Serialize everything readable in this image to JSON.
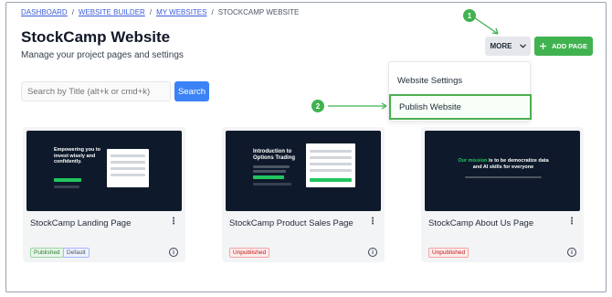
{
  "breadcrumb": {
    "items": [
      "DASHBOARD",
      "WEBSITE BUILDER",
      "MY WEBSITES",
      "STOCKCAMP WEBSITE"
    ],
    "separator": "/"
  },
  "header": {
    "title": "StockCamp Website",
    "subtitle": "Manage your project pages and settings"
  },
  "search": {
    "placeholder": "Search by Title (alt+k or cmd+k)",
    "button_label": "Search"
  },
  "toolbar": {
    "more_label": "MORE",
    "add_page_label": "ADD PAGE"
  },
  "dropdown": {
    "items": [
      "Website Settings",
      "Publish Website"
    ],
    "highlighted": "Publish Website"
  },
  "annotations": {
    "step1": "1",
    "step2": "2",
    "accent": "#40b24f"
  },
  "cards": [
    {
      "title": "StockCamp Landing Page",
      "badges": [
        "Published",
        "Default"
      ],
      "thumb": {
        "heading": "Empowering you to invest wisely and confidently."
      }
    },
    {
      "title": "StockCamp Product Sales Page",
      "badges": [
        "Unpublished"
      ],
      "thumb": {
        "heading": "Introduction to Options Trading"
      }
    },
    {
      "title": "StockCamp About Us Page",
      "badges": [
        "Unpublished"
      ],
      "thumb": {
        "heading_green": "Our mission",
        "heading_rest": " is to be democratize data and AI skills for everyone"
      }
    }
  ],
  "icons": {
    "more_chevron": "chevron-down-icon",
    "add": "plus-icon",
    "kebab": "kebab-menu-icon",
    "info": "info-icon"
  },
  "colors": {
    "primary_blue": "#3b82f6",
    "green": "#40b24f",
    "link": "#3b5bdb",
    "thumb_bg": "#0e1a2b"
  }
}
